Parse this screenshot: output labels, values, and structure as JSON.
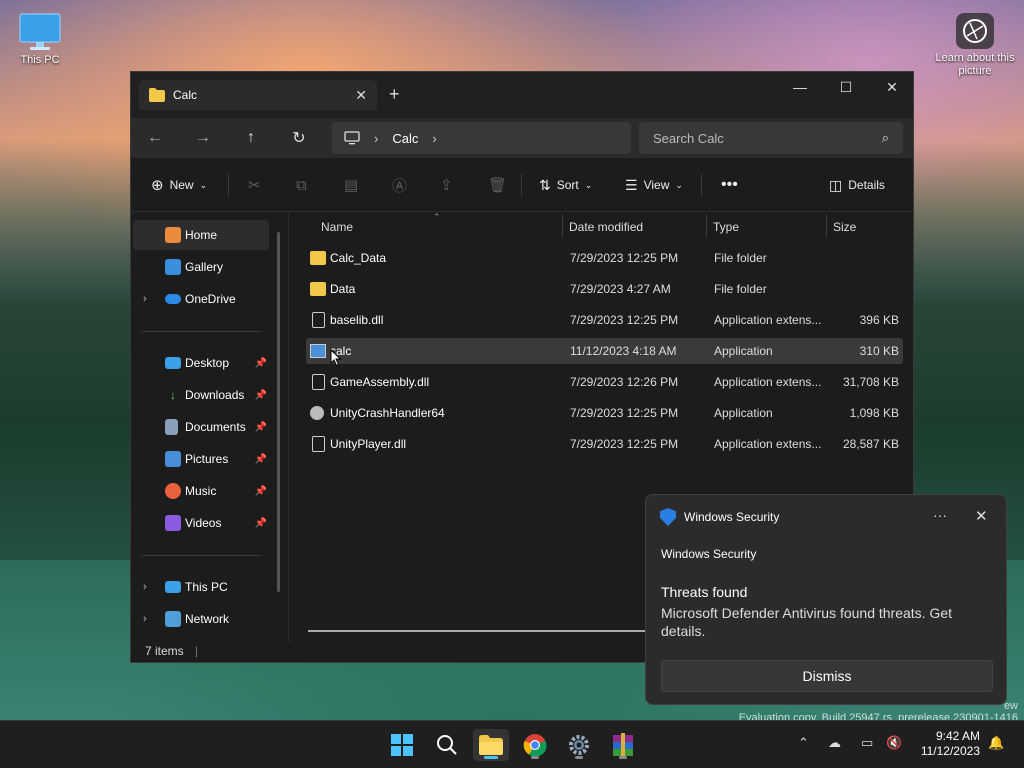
{
  "desktop": {
    "this_pc_label": "This PC",
    "learn_label": "Learn about this picture",
    "watermark_line1": "ew",
    "watermark_line2": "Evaluation copy. Build 25947.rs_prerelease.230901-1416"
  },
  "explorer": {
    "tab_title": "Calc",
    "new_tab": "+",
    "address_segments": [
      "Calc"
    ],
    "search_placeholder": "Search Calc",
    "toolbar": {
      "new_label": "New",
      "sort_label": "Sort",
      "view_label": "View",
      "details_label": "Details"
    },
    "sidebar": {
      "home": "Home",
      "gallery": "Gallery",
      "onedrive": "OneDrive",
      "desktop": "Desktop",
      "downloads": "Downloads",
      "documents": "Documents",
      "pictures": "Pictures",
      "music": "Music",
      "videos": "Videos",
      "thispc": "This PC",
      "network": "Network"
    },
    "columns": {
      "name": "Name",
      "date": "Date modified",
      "type": "Type",
      "size": "Size"
    },
    "files": [
      {
        "name": "Calc_Data",
        "date": "7/29/2023 12:25 PM",
        "type": "File folder",
        "size": "",
        "icon": "folder-icon"
      },
      {
        "name": "Data",
        "date": "7/29/2023 4:27 AM",
        "type": "File folder",
        "size": "",
        "icon": "folder-icon"
      },
      {
        "name": "baselib.dll",
        "date": "7/29/2023 12:25 PM",
        "type": "Application extens...",
        "size": "396 KB",
        "icon": "dll-icon"
      },
      {
        "name": "calc",
        "date": "11/12/2023 4:18 AM",
        "type": "Application",
        "size": "310 KB",
        "icon": "app-icon"
      },
      {
        "name": "GameAssembly.dll",
        "date": "7/29/2023 12:26 PM",
        "type": "Application extens...",
        "size": "31,708 KB",
        "icon": "dll-icon"
      },
      {
        "name": "UnityCrashHandler64",
        "date": "7/29/2023 12:25 PM",
        "type": "Application",
        "size": "1,098 KB",
        "icon": "crash-handler-icon"
      },
      {
        "name": "UnityPlayer.dll",
        "date": "7/29/2023 12:25 PM",
        "type": "Application extens...",
        "size": "28,587 KB",
        "icon": "dll-icon"
      }
    ],
    "status": "7 items"
  },
  "toast": {
    "app_name": "Windows Security",
    "subtitle": "Windows Security",
    "heading": "Threats found",
    "message": "Microsoft Defender Antivirus found threats. Get details.",
    "dismiss": "Dismiss"
  },
  "taskbar": {
    "time": "9:42 AM",
    "date": "11/12/2023"
  },
  "colors": {
    "accent": "#4cc2ff",
    "folder": "#f2c84b",
    "defender": "#2a7de1"
  }
}
